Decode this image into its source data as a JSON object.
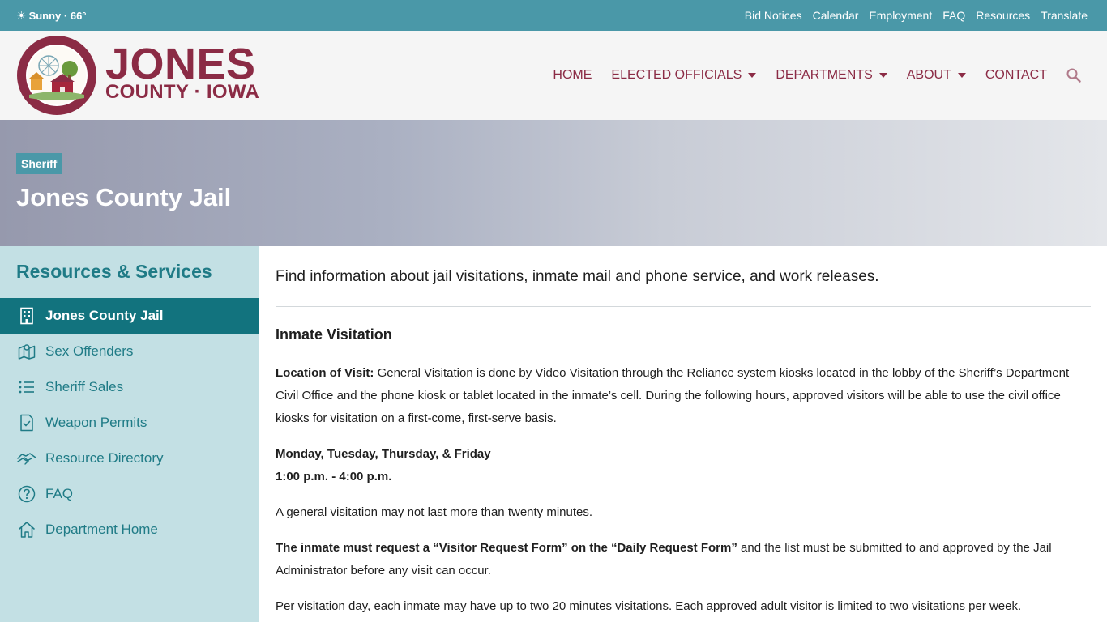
{
  "topbar": {
    "weather": "Sunny · 66°",
    "links": [
      "Bid Notices",
      "Calendar",
      "Employment",
      "FAQ",
      "Resources",
      "Translate"
    ]
  },
  "brand": {
    "name_big": "JONES",
    "name_small": "COUNTY · IOWA"
  },
  "nav": {
    "items": [
      "HOME",
      "ELECTED OFFICIALS",
      "DEPARTMENTS",
      "ABOUT",
      "CONTACT"
    ]
  },
  "hero": {
    "tag": "Sheriff",
    "title": "Jones County Jail"
  },
  "sidebar": {
    "heading": "Resources & Services",
    "items": [
      {
        "label": "Jones County Jail",
        "icon": "building-icon",
        "active": true
      },
      {
        "label": "Sex Offenders",
        "icon": "map-icon",
        "active": false
      },
      {
        "label": "Sheriff Sales",
        "icon": "list-icon",
        "active": false
      },
      {
        "label": "Weapon Permits",
        "icon": "document-check-icon",
        "active": false
      },
      {
        "label": "Resource Directory",
        "icon": "handshake-icon",
        "active": false
      },
      {
        "label": "FAQ",
        "icon": "question-icon",
        "active": false
      },
      {
        "label": "Department Home",
        "icon": "home-icon",
        "active": false
      }
    ]
  },
  "content": {
    "intro": "Find information about jail visitations, inmate mail and phone service, and work releases.",
    "section_title": "Inmate Visitation",
    "location_label": "Location of Visit:",
    "location_text": " General Visitation is done by Video Visitation through the Reliance system kiosks located in the lobby of the Sheriff’s Department Civil Office and the phone kiosk or tablet located in the inmate’s cell. During the following hours, approved visitors will be able to use the civil office kiosks for visitation on a first-come, first-serve basis.",
    "days": "Monday, Tuesday, Thursday, & Friday",
    "hours": "1:00 p.m. - 4:00 p.m.",
    "limit_text": "A general visitation may not last more than twenty minutes.",
    "request_bold": "The inmate must request a “Visitor Request Form” on the “Daily Request Form”",
    "request_text": " and the list must be submitted to and approved by the Jail Administrator before any visit can occur.",
    "per_day_text": "Per visitation day, each inmate may have up to two 20 minutes visitations. Each approved adult visitor is limited to two visitations per week."
  },
  "colors": {
    "topbar": "#4a98a8",
    "brand": "#8b2b45",
    "sidebar_bg": "#c3e0e4",
    "sidebar_active": "#12737e",
    "sidebar_text": "#1f7b86"
  }
}
